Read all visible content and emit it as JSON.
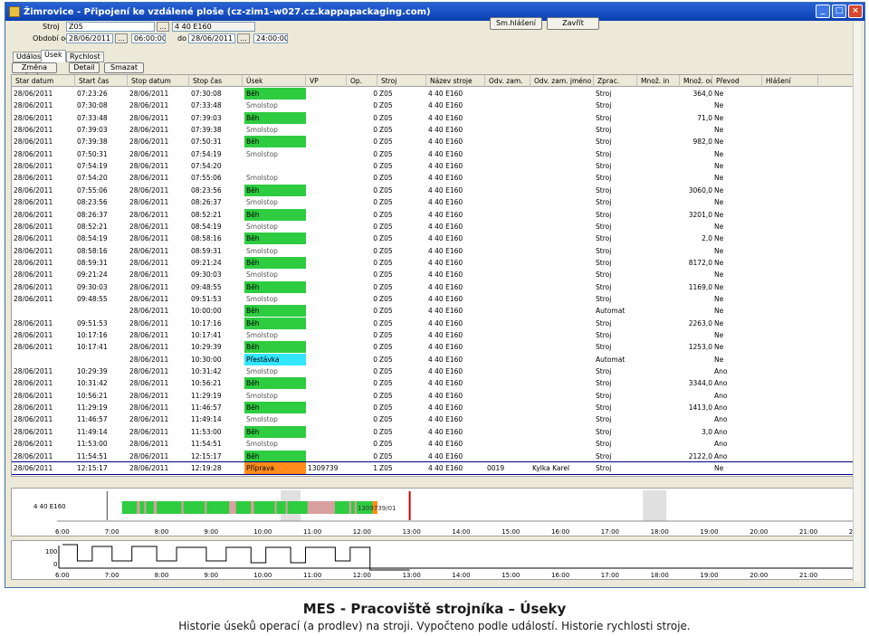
{
  "window": {
    "title": "Žimrovice - Připojení ke vzdálené ploše (cz-zim1-w027.cz.kappapackaging.com)",
    "min": "_",
    "max": "□",
    "close": "×"
  },
  "filter": {
    "stroj_label": "Stroj",
    "stroj_value": "Z05",
    "stroj_btn": "...",
    "stroj_name": "4 40 E160",
    "obdobi_label": "Období od",
    "od_date": "28/06/2011",
    "od_btn": "...",
    "od_time": "06:00:00",
    "do_label": "do",
    "do_date": "28/06/2011",
    "do_btn": "...",
    "do_time": "24:00:00"
  },
  "buttons": {
    "sm_hlaseni": "Sm.hlášení",
    "zavrit": "Zavřít"
  },
  "tabs": [
    "Událost",
    "Úsek",
    "Rychlost"
  ],
  "actions": {
    "zmena": "Změna úseku",
    "detail": "Detail",
    "smazat": "Smazat"
  },
  "columns": [
    "Star datum",
    "Start čas",
    "Stop datum",
    "Stop čas",
    "Úsek",
    "VP",
    "Op.",
    "Stroj",
    "Název stroje",
    "Odv. zam.",
    "Odv. zam. jméno zam.",
    "Zprac.",
    "Množ. in",
    "Množ. out",
    "Převod",
    "Hlášení"
  ],
  "colors": {
    "beh": "#2ecc40",
    "smolstop": "#ffffff",
    "prestavka": "#33e6ff",
    "priprava": "#ff8c1a",
    "selection": "#000080"
  },
  "rows": [
    [
      "28/06/2011",
      "07:23:26",
      "28/06/2011",
      "07:30:08",
      "Běh",
      "",
      "0",
      "Z05",
      "4 40 E160",
      "",
      "",
      "Stroj",
      "",
      "364,0",
      "Ne",
      ""
    ],
    [
      "28/06/2011",
      "07:30:08",
      "28/06/2011",
      "07:33:48",
      "Smolstop",
      "",
      "0",
      "Z05",
      "4 40 E160",
      "",
      "",
      "Stroj",
      "",
      "",
      "Ne",
      ""
    ],
    [
      "28/06/2011",
      "07:33:48",
      "28/06/2011",
      "07:39:03",
      "Běh",
      "",
      "0",
      "Z05",
      "4 40 E160",
      "",
      "",
      "Stroj",
      "",
      "71,0",
      "Ne",
      ""
    ],
    [
      "28/06/2011",
      "07:39:03",
      "28/06/2011",
      "07:39:38",
      "Smolstop",
      "",
      "0",
      "Z05",
      "4 40 E160",
      "",
      "",
      "Stroj",
      "",
      "",
      "Ne",
      ""
    ],
    [
      "28/06/2011",
      "07:39:38",
      "28/06/2011",
      "07:50:31",
      "Běh",
      "",
      "0",
      "Z05",
      "4 40 E160",
      "",
      "",
      "Stroj",
      "",
      "982,0",
      "Ne",
      ""
    ],
    [
      "28/06/2011",
      "07:50:31",
      "28/06/2011",
      "07:54:19",
      "Smolstop",
      "",
      "0",
      "Z05",
      "4 40 E160",
      "",
      "",
      "Stroj",
      "",
      "",
      "Ne",
      ""
    ],
    [
      "28/06/2011",
      "07:54:19",
      "28/06/2011",
      "07:54:20",
      "",
      "",
      "0",
      "Z05",
      "4 40 E160",
      "",
      "",
      "Stroj",
      "",
      "",
      "Ne",
      ""
    ],
    [
      "28/06/2011",
      "07:54:20",
      "28/06/2011",
      "07:55:06",
      "Smolstop",
      "",
      "0",
      "Z05",
      "4 40 E160",
      "",
      "",
      "Stroj",
      "",
      "",
      "Ne",
      ""
    ],
    [
      "28/06/2011",
      "07:55:06",
      "28/06/2011",
      "08:23:56",
      "Běh",
      "",
      "0",
      "Z05",
      "4 40 E160",
      "",
      "",
      "Stroj",
      "",
      "3060,0",
      "Ne",
      ""
    ],
    [
      "28/06/2011",
      "08:23:56",
      "28/06/2011",
      "08:26:37",
      "Smolstop",
      "",
      "0",
      "Z05",
      "4 40 E160",
      "",
      "",
      "Stroj",
      "",
      "",
      "Ne",
      ""
    ],
    [
      "28/06/2011",
      "08:26:37",
      "28/06/2011",
      "08:52:21",
      "Běh",
      "",
      "0",
      "Z05",
      "4 40 E160",
      "",
      "",
      "Stroj",
      "",
      "3201,0",
      "Ne",
      ""
    ],
    [
      "28/06/2011",
      "08:52:21",
      "28/06/2011",
      "08:54:19",
      "Smolstop",
      "",
      "0",
      "Z05",
      "4 40 E160",
      "",
      "",
      "Stroj",
      "",
      "",
      "Ne",
      ""
    ],
    [
      "28/06/2011",
      "08:54:19",
      "28/06/2011",
      "08:58:16",
      "Běh",
      "",
      "0",
      "Z05",
      "4 40 E160",
      "",
      "",
      "Stroj",
      "",
      "2,0",
      "Ne",
      ""
    ],
    [
      "28/06/2011",
      "08:58:16",
      "28/06/2011",
      "08:59:31",
      "Smolstop",
      "",
      "0",
      "Z05",
      "4 40 E160",
      "",
      "",
      "Stroj",
      "",
      "",
      "Ne",
      ""
    ],
    [
      "28/06/2011",
      "08:59:31",
      "28/06/2011",
      "09:21:24",
      "Běh",
      "",
      "0",
      "Z05",
      "4 40 E160",
      "",
      "",
      "Stroj",
      "",
      "8172,0",
      "Ne",
      ""
    ],
    [
      "28/06/2011",
      "09:21:24",
      "28/06/2011",
      "09:30:03",
      "Smolstop",
      "",
      "0",
      "Z05",
      "4 40 E160",
      "",
      "",
      "Stroj",
      "",
      "",
      "Ne",
      ""
    ],
    [
      "28/06/2011",
      "09:30:03",
      "28/06/2011",
      "09:48:55",
      "Běh",
      "",
      "0",
      "Z05",
      "4 40 E160",
      "",
      "",
      "Stroj",
      "",
      "1169,0",
      "Ne",
      ""
    ],
    [
      "28/06/2011",
      "09:48:55",
      "28/06/2011",
      "09:51:53",
      "Smolstop",
      "",
      "0",
      "Z05",
      "4 40 E160",
      "",
      "",
      "Stroj",
      "",
      "",
      "Ne",
      ""
    ],
    [
      "",
      "",
      "28/06/2011",
      "10:00:00",
      "Běh",
      "",
      "0",
      "Z05",
      "4 40 E160",
      "",
      "",
      "Automat",
      "",
      "",
      "Ne",
      ""
    ],
    [
      "28/06/2011",
      "09:51:53",
      "28/06/2011",
      "10:17:16",
      "Běh",
      "",
      "0",
      "Z05",
      "4 40 E160",
      "",
      "",
      "Stroj",
      "",
      "2263,0",
      "Ne",
      ""
    ],
    [
      "28/06/2011",
      "10:17:16",
      "28/06/2011",
      "10:17:41",
      "Smolstop",
      "",
      "0",
      "Z05",
      "4 40 E160",
      "",
      "",
      "Stroj",
      "",
      "",
      "Ne",
      ""
    ],
    [
      "28/06/2011",
      "10:17:41",
      "28/06/2011",
      "10:29:39",
      "Běh",
      "",
      "0",
      "Z05",
      "4 40 E160",
      "",
      "",
      "Stroj",
      "",
      "1253,0",
      "Ne",
      ""
    ],
    [
      "",
      "",
      "28/06/2011",
      "10:30:00",
      "Přestávka",
      "",
      "0",
      "Z05",
      "4 40 E160",
      "",
      "",
      "Automat",
      "",
      "",
      "Ne",
      ""
    ],
    [
      "28/06/2011",
      "10:29:39",
      "28/06/2011",
      "10:31:42",
      "Smolstop",
      "",
      "0",
      "Z05",
      "4 40 E160",
      "",
      "",
      "Stroj",
      "",
      "",
      "Ano",
      ""
    ],
    [
      "28/06/2011",
      "10:31:42",
      "28/06/2011",
      "10:56:21",
      "Běh",
      "",
      "0",
      "Z05",
      "4 40 E160",
      "",
      "",
      "Stroj",
      "",
      "3344,0",
      "Ano",
      ""
    ],
    [
      "28/06/2011",
      "10:56:21",
      "28/06/2011",
      "11:29:19",
      "Smolstop",
      "",
      "0",
      "Z05",
      "4 40 E160",
      "",
      "",
      "Stroj",
      "",
      "",
      "Ano",
      ""
    ],
    [
      "28/06/2011",
      "11:29:19",
      "28/06/2011",
      "11:46:57",
      "Běh",
      "",
      "0",
      "Z05",
      "4 40 E160",
      "",
      "",
      "Stroj",
      "",
      "1413,0",
      "Ano",
      ""
    ],
    [
      "28/06/2011",
      "11:46:57",
      "28/06/2011",
      "11:49:14",
      "Smolstop",
      "",
      "0",
      "Z05",
      "4 40 E160",
      "",
      "",
      "Stroj",
      "",
      "",
      "Ano",
      ""
    ],
    [
      "28/06/2011",
      "11:49:14",
      "28/06/2011",
      "11:53:00",
      "Běh",
      "",
      "0",
      "Z05",
      "4 40 E160",
      "",
      "",
      "Stroj",
      "",
      "3,0",
      "Ano",
      ""
    ],
    [
      "28/06/2011",
      "11:53:00",
      "28/06/2011",
      "11:54:51",
      "Smolstop",
      "",
      "0",
      "Z05",
      "4 40 E160",
      "",
      "",
      "Stroj",
      "",
      "",
      "Ano",
      ""
    ],
    [
      "28/06/2011",
      "11:54:51",
      "28/06/2011",
      "12:15:17",
      "Běh",
      "",
      "0",
      "Z05",
      "4 40 E160",
      "",
      "",
      "Stroj",
      "",
      "2122,0",
      "Ano",
      ""
    ],
    [
      "28/06/2011",
      "12:15:17",
      "28/06/2011",
      "12:19:28",
      "Příprava",
      "1309739",
      "1",
      "Z05",
      "4 40 E160",
      "0019",
      "Kylka Karel",
      "Stroj",
      "",
      "",
      "Ne",
      ""
    ]
  ],
  "timeline": {
    "label": "4 40 E160",
    "vp_label": "1309739/01",
    "ticks": [
      "6:00",
      "7:00",
      "8:00",
      "9:00",
      "10:00",
      "11:00",
      "12:00",
      "13:00",
      "14:00",
      "15:00",
      "16:00",
      "17:00",
      "18:00",
      "19:00",
      "20:00",
      "21:00",
      "22"
    ],
    "ticks2": [
      "6:00",
      "7:00",
      "8:00",
      "9:00",
      "10:00",
      "11:00",
      "12:00",
      "13:00",
      "14:00",
      "15:00",
      "16:00",
      "17:00",
      "18:00",
      "19:00",
      "20:00",
      "21:00"
    ],
    "speed_max": "100",
    "speed_min": "0"
  },
  "caption": {
    "title": "MES - Pracoviště strojníka – Úseky",
    "subtitle": "Historie úseků operací (a prodlev) na stroji. Vypočteno podle událostí. Historie rychlosti stroje."
  }
}
